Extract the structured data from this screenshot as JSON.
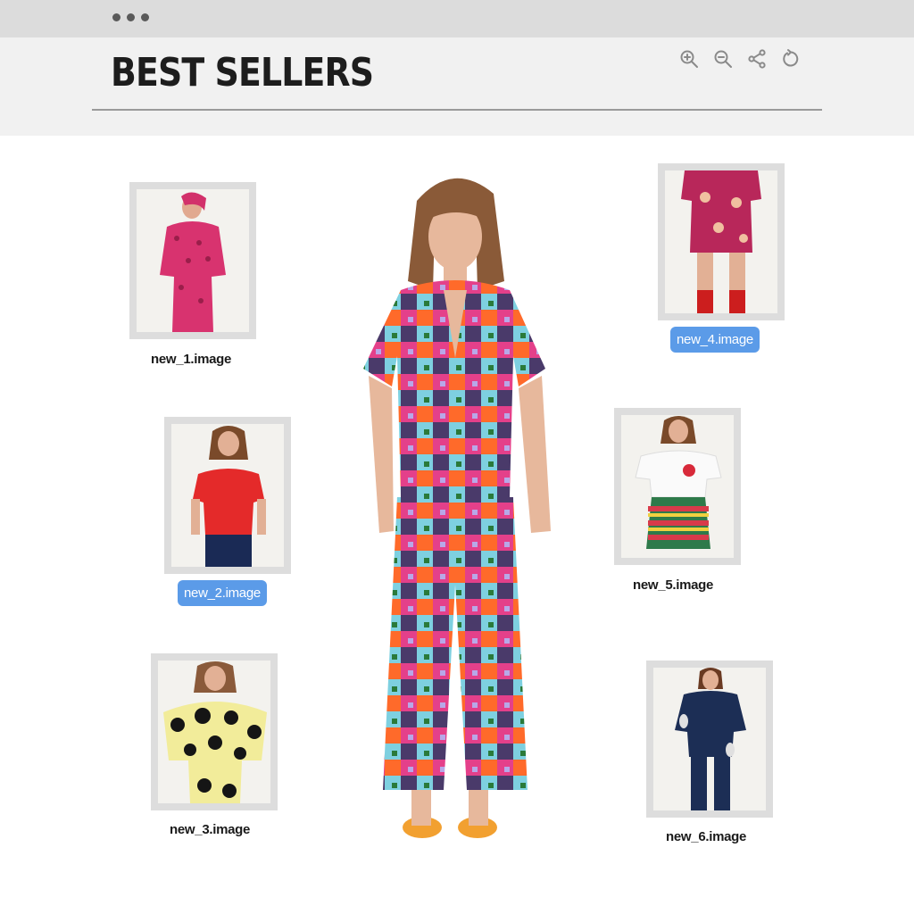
{
  "window": {
    "title": "BEST SELLERS",
    "toolbar": [
      {
        "name": "zoom-in-icon",
        "label": "Zoom in"
      },
      {
        "name": "zoom-out-icon",
        "label": "Zoom out"
      },
      {
        "name": "share-icon",
        "label": "Share"
      },
      {
        "name": "rotate-icon",
        "label": "Rotate"
      }
    ]
  },
  "gallery": {
    "items": [
      {
        "label": "new_1.image",
        "selected": false
      },
      {
        "label": "new_2.image",
        "selected": true
      },
      {
        "label": "new_3.image",
        "selected": false
      },
      {
        "label": "new_4.image",
        "selected": true
      },
      {
        "label": "new_5.image",
        "selected": false
      },
      {
        "label": "new_6.image",
        "selected": false
      }
    ]
  },
  "colors": {
    "selection": "#5b9be8",
    "titlebar": "#dcdcdc",
    "header": "#f1f1f1",
    "frame": "#dddddd"
  }
}
